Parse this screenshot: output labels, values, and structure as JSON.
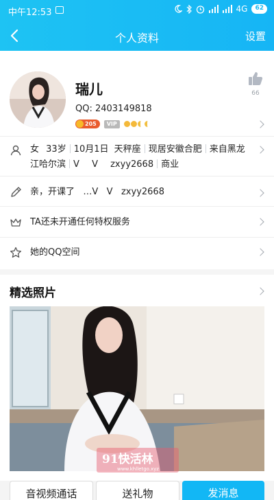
{
  "status_bar": {
    "time": "中午12:53",
    "battery": "62",
    "network": "4G"
  },
  "nav": {
    "title": "个人资料",
    "settings_label": "设置"
  },
  "profile": {
    "name": "瑞儿",
    "qq": "QQ: 2403149818",
    "points_badge": "205",
    "vip_badge": "VIP",
    "like_count": "66"
  },
  "info": {
    "line1": [
      "女",
      "33岁",
      "10月1日",
      "天秤座",
      "现居安徽合肥",
      "来自黑龙"
    ],
    "line2": [
      "江哈尔滨",
      "V",
      "V",
      "zxyy2668",
      "商业"
    ]
  },
  "signature": "亲，开课了   …V   V   zxyy2668",
  "privilege": "TA还未开通任何特权服务",
  "qzone": "她的QQ空间",
  "photos_title": "精选照片",
  "watermark": {
    "main": "91快活林",
    "sub": "www.khlletgo.xyz"
  },
  "actions": {
    "call": "音视频通话",
    "gift": "送礼物",
    "message": "发消息"
  },
  "colors": {
    "accent": "#12b7f5",
    "header_start": "#1ec3f3",
    "header_end": "#16b5f5"
  },
  "icons": [
    "back-arrow-icon",
    "thumbs-up-icon",
    "person-icon",
    "pencil-icon",
    "crown-icon",
    "star-icon",
    "chevron-right-icon"
  ]
}
